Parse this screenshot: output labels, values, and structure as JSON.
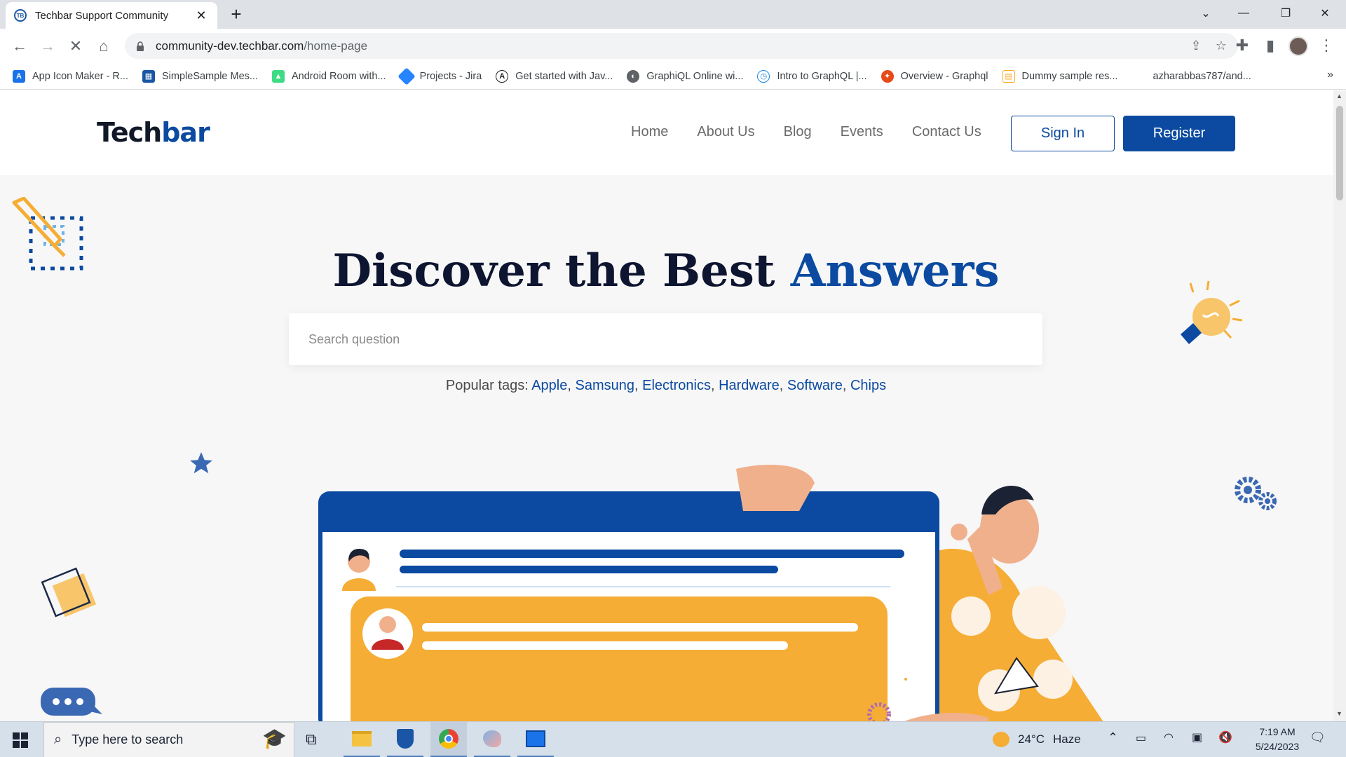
{
  "browser": {
    "tab_title": "Techbar Support Community",
    "tab_favicon_text": "TB",
    "url_host": "community-dev.techbar.com",
    "url_path": "/home-page",
    "bookmarks": [
      {
        "label": "App Icon Maker - R...",
        "color": "#1a73e8"
      },
      {
        "label": "SimpleSample Mes...",
        "color": "#1a56a5"
      },
      {
        "label": "Android Room with...",
        "color": "#3ddc84"
      },
      {
        "label": "Projects - Jira",
        "color": "#2684ff"
      },
      {
        "label": "Get started with Jav...",
        "color": "#202124"
      },
      {
        "label": "GraphiQL Online wi...",
        "color": "#5f6368"
      },
      {
        "label": "Intro to GraphQL |...",
        "color": "#1e88e5"
      },
      {
        "label": "Overview - Graphql",
        "color": "#e64a19"
      },
      {
        "label": "Dummy sample res...",
        "color": "#f9a825"
      },
      {
        "label": "azharabbas787/and...",
        "color": ""
      }
    ]
  },
  "site": {
    "logo_part1": "Tech",
    "logo_part2": "bar",
    "nav": [
      "Home",
      "About Us",
      "Blog",
      "Events",
      "Contact Us"
    ],
    "signin": "Sign In",
    "register": "Register",
    "hero_title_part1": "Discover the Best ",
    "hero_title_part2": "Answers",
    "search_placeholder": "Search question",
    "popular_label": "Popular tags: ",
    "tags": [
      "Apple",
      "Samsung",
      "Electronics",
      "Hardware",
      "Software",
      "Chips"
    ]
  },
  "taskbar": {
    "search_placeholder": "Type here to search",
    "weather_temp": "24°C",
    "weather_text": "Haze",
    "time": "7:19 AM",
    "date": "5/24/2023"
  },
  "colors": {
    "brand_blue": "#0b4aa0",
    "accent_orange": "#f5ad35",
    "page_bg": "#f7f7f7"
  }
}
